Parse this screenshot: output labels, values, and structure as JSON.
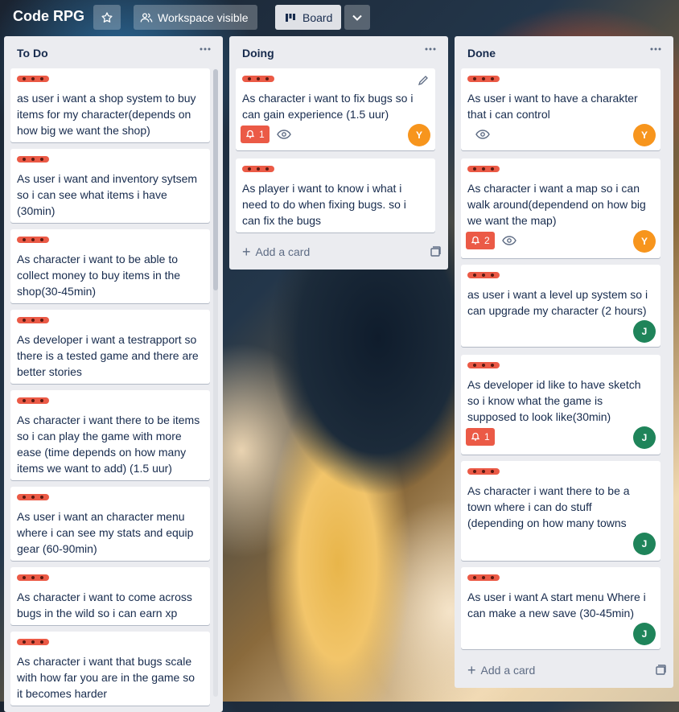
{
  "header": {
    "board_title": "Code RPG",
    "star_icon": "star-icon",
    "workspace_label": "Workspace visible",
    "view_label": "Board",
    "expand_icon": "chevron-down-icon"
  },
  "colors": {
    "label_red": "#eb5a46",
    "alert_red": "#eb5a46",
    "avatar_y": "#f7951d",
    "avatar_j": "#1f845a",
    "list_bg": "#ebecf0"
  },
  "lists": {
    "todo": {
      "title": "To Do",
      "cards": [
        {
          "text": "as user i want a shop system to buy items for my character(depends on how big we want the shop)"
        },
        {
          "text": "As user i want and inventory sytsem so i can see what items i have (30min)"
        },
        {
          "text": "As character i want to be able to collect money to buy items in the shop(30-45min)"
        },
        {
          "text": "As developer i want a testrapport so there is a tested game and there are better stories"
        },
        {
          "text": "As character i want there to be items so i can play the game with more ease (time depends on how many items we want to add) (1.5 uur)"
        },
        {
          "text": "As user i want an character menu where i can see my stats and equip gear (60-90min)"
        },
        {
          "text": "As character i want to come across bugs in the wild so i can earn xp"
        },
        {
          "text": "As character i want that bugs scale with how far you are in the game so it becomes harder"
        }
      ]
    },
    "doing": {
      "title": "Doing",
      "cards": [
        {
          "text": "As character i want to fix bugs so i can gain experience (1.5 uur)",
          "alerts": "1",
          "avatar": "Y"
        },
        {
          "text": "As player i want to know i what i need to do when fixing bugs. so i can fix the bugs"
        }
      ],
      "add_card": "Add a card"
    },
    "done": {
      "title": "Done",
      "cards": [
        {
          "text": "As user i want to have a charakter that i can control",
          "avatar": "Y"
        },
        {
          "text": "As character i want a map so i can walk around(dependend on how big we want the map)",
          "alerts": "2",
          "avatar": "Y"
        },
        {
          "text": "as user i want a level up system so i can upgrade my character (2 hours)",
          "avatar": "J"
        },
        {
          "text": "As developer id like to have sketch so i know what the game is supposed to look like(30min)",
          "alerts": "1",
          "avatar": "J"
        },
        {
          "text": "As character i want there to be a town where i can do stuff (depending on how many towns",
          "avatar": "J"
        },
        {
          "text": "As user i want A start menu Where i can make a new save (30-45min)",
          "avatar": "J"
        }
      ],
      "add_card": "Add a card"
    }
  }
}
